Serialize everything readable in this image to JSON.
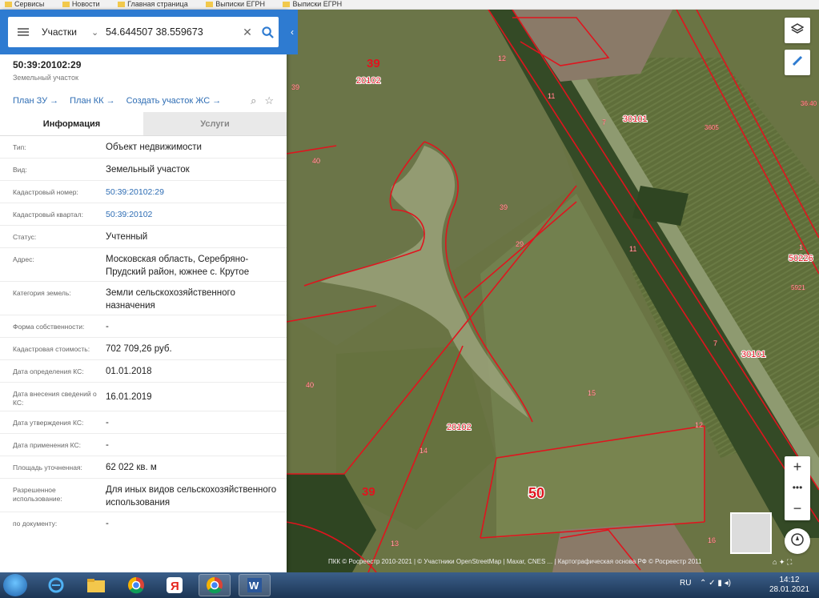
{
  "bookmarks": [
    "Сервисы",
    "Новости",
    "Главная страница",
    "Выписки ЕГРН",
    "Выписки ЕГРН"
  ],
  "search": {
    "type": "Участки",
    "query": "54.644507 38.559673"
  },
  "object": {
    "number": "50:39:20102:29",
    "type": "Земельный участок"
  },
  "actions": {
    "plan_zu": "План ЗУ →",
    "plan_kk": "План КК →",
    "create_zs": "Создать участок ЖС →"
  },
  "tabs": {
    "info": "Информация",
    "services": "Услуги"
  },
  "info_rows": [
    {
      "label": "Тип:",
      "value": "Объект недвижимости"
    },
    {
      "label": "Вид:",
      "value": "Земельный участок"
    },
    {
      "label": "Кадастровый номер:",
      "value": "50:39:20102:29"
    },
    {
      "label": "Кадастровый квартал:",
      "value": "50:39:20102"
    },
    {
      "label": "Статус:",
      "value": "Учтенный"
    },
    {
      "label": "Адрес:",
      "value": "Московская область, Серебряно-Прудский район, южнее с. Крутое"
    },
    {
      "label": "Категория земель:",
      "value": "Земли сельскохозяйственного назначения"
    },
    {
      "label": "Форма собственности:",
      "value": "-"
    },
    {
      "label": "Кадастровая стоимость:",
      "value": "702 709,26 руб."
    },
    {
      "label": "Дата определения КС:",
      "value": "01.01.2018"
    },
    {
      "label": "Дата внесения сведений о КС:",
      "value": "16.01.2019"
    },
    {
      "label": "Дата утверждения КС:",
      "value": "-"
    },
    {
      "label": "Дата применения КС:",
      "value": "-"
    },
    {
      "label": "Площадь уточненная:",
      "value": "62 022 кв. м"
    },
    {
      "label": "Разрешенное использование:",
      "value": "Для иных видов сельскохозяйственного использования"
    },
    {
      "label": "по документу:",
      "value": "-"
    }
  ],
  "map_labels": [
    "39",
    "20102",
    "39",
    "40",
    "12",
    "11",
    "7",
    "30101",
    "39",
    "29",
    "11",
    "1",
    "50226",
    "7",
    "30101",
    "40",
    "15",
    "20102",
    "14",
    "12",
    "39",
    "50",
    "13",
    "16",
    "36:40",
    "3605",
    "5921"
  ],
  "attribution": "ПКК © Росреестр 2010-2021 | © Участники OpenStreetMap | Maxar, CNES ... | Картографическая основа РФ © Росреестр 2011",
  "taskbar": {
    "lang": "RU",
    "time": "14:12",
    "date": "28.01.2021"
  },
  "colors": {
    "accent": "#2e7bd1",
    "link": "#2e6db4",
    "parcel_border": "#e0141e"
  }
}
